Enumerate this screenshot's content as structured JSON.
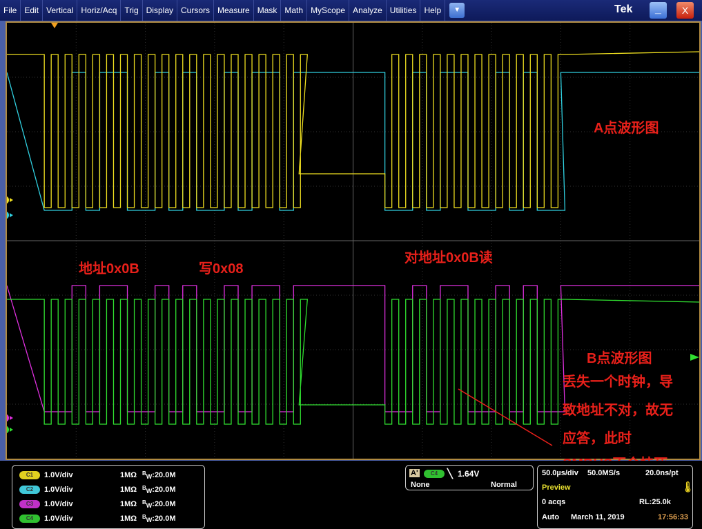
{
  "menu": [
    "File",
    "Edit",
    "Vertical",
    "Horiz/Acq",
    "Trig",
    "Display",
    "Cursors",
    "Measure",
    "Mask",
    "Math",
    "MyScope",
    "Analyze",
    "Utilities",
    "Help"
  ],
  "window": {
    "brand": "Tek",
    "minimize": "_",
    "close": "X",
    "dropdown": "▼"
  },
  "colors": {
    "ch1": "#f0e020",
    "ch2": "#30d0e0",
    "ch3": "#e030e0",
    "ch4": "#30e030",
    "annotation": "#e8201a",
    "trigger_marker": "#f0a020"
  },
  "channel_markers": [
    "1",
    "2",
    "3",
    "4"
  ],
  "annotations": {
    "a_wave": "A点波形图",
    "addr": "地址0x0B",
    "write": "写0x08",
    "read": "对地址0x0B读",
    "b_wave": "B点波形图",
    "note1": "丢失一个时钟，导",
    "note2": "致地址不对，故无",
    "note3": "应答，此时",
    "note4": "SMBUS不会挂死"
  },
  "channels": [
    {
      "pill": "C1",
      "scale": "1.0V/div",
      "imp": "1MΩ",
      "bw_b": "B",
      "bw_w": "W",
      "bw": ":20.0M",
      "color": "#e0d020"
    },
    {
      "pill": "C2",
      "scale": "1.0V/div",
      "imp": "1MΩ",
      "bw_b": "B",
      "bw_w": "W",
      "bw": ":20.0M",
      "color": "#40c8d8"
    },
    {
      "pill": "C3",
      "scale": "1.0V/div",
      "imp": "1MΩ",
      "bw_b": "B",
      "bw_w": "W",
      "bw": ":20.0M",
      "color": "#c030c8"
    },
    {
      "pill": "C4",
      "scale": "1.0V/div",
      "imp": "1MΩ",
      "bw_b": "B",
      "bw_w": "W",
      "bw": ":20.0M",
      "color": "#30c030"
    }
  ],
  "trigger": {
    "label": "A'",
    "source": "C4",
    "slope": "falling",
    "level": "1.64V",
    "coupling": "None",
    "mode": "Normal"
  },
  "acquisition": {
    "timebase": "50.0µs/div",
    "sample_rate": "50.0MS/s",
    "resolution": "20.0ns/pt",
    "state": "Preview",
    "acqs": "0 acqs",
    "record_length": "RL:25.0k",
    "run_mode": "Auto",
    "date": "March 11, 2019",
    "time": "17:56:33"
  },
  "waveforms": {
    "time_per_div_us": 50,
    "bursts_us": [
      [
        27,
        211
      ],
      [
        273,
        400
      ]
    ],
    "clock_period_us": 10,
    "ch2_bits": "0010110010100101101",
    "ch3_bits": "0010110010100101101",
    "idle_gap_us": [
      211,
      273
    ]
  }
}
